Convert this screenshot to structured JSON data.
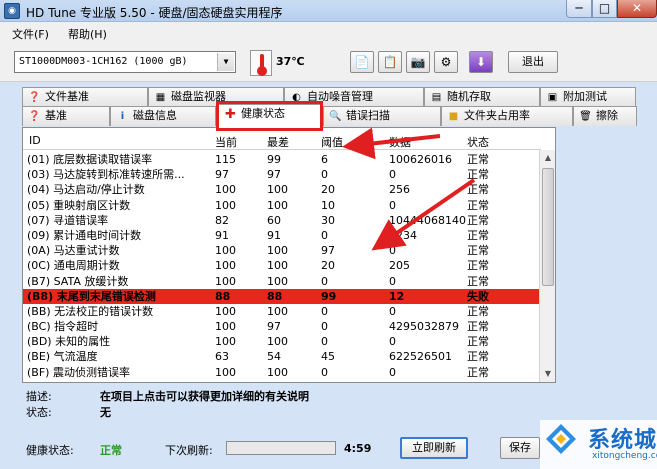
{
  "window": {
    "title": "HD Tune 专业版 5.50 - 硬盘/固态硬盘实用程序",
    "min_glyph": "─",
    "max_glyph": "□",
    "close_glyph": "✕"
  },
  "menu": [
    {
      "label": "文件(F)"
    },
    {
      "label": "帮助(H)"
    }
  ],
  "toolbar": {
    "drive": "ST1000DM003-1CH162 (1000 gB)",
    "temperature": "37℃",
    "exit_label": "退出",
    "icons": [
      "copy-text-icon",
      "copy-icon",
      "camera-icon",
      "options-icon",
      "download-icon"
    ]
  },
  "tabs": {
    "row1": [
      {
        "label": "文件基准"
      },
      {
        "label": "磁盘监视器"
      },
      {
        "label": "自动噪音管理"
      },
      {
        "label": "随机存取"
      },
      {
        "label": "附加测试"
      }
    ],
    "row2": [
      {
        "label": "基准"
      },
      {
        "label": "磁盘信息"
      },
      {
        "label": "健康状态"
      },
      {
        "label": "错误扫描"
      },
      {
        "label": "文件夹占用率"
      },
      {
        "label": "擦除"
      }
    ],
    "active": "健康状态"
  },
  "table": {
    "headers": [
      "ID",
      "当前",
      "最差",
      "阈值",
      "数据",
      "状态"
    ],
    "rows": [
      [
        "(01) 底层数据读取错误率",
        "115",
        "99",
        "6",
        "100626016",
        "正常"
      ],
      [
        "(03) 马达旋转到标准转速所需...",
        "97",
        "97",
        "0",
        "0",
        "正常"
      ],
      [
        "(04) 马达启动/停止计数",
        "100",
        "100",
        "20",
        "256",
        "正常"
      ],
      [
        "(05) 重映射扇区计数",
        "100",
        "100",
        "10",
        "0",
        "正常"
      ],
      [
        "(07) 寻道错误率",
        "82",
        "60",
        "30",
        "10444068140",
        "正常"
      ],
      [
        "(09) 累计通电时间计数",
        "91",
        "91",
        "0",
        "8234",
        "正常"
      ],
      [
        "(0A) 马达重试计数",
        "100",
        "100",
        "97",
        "0",
        "正常"
      ],
      [
        "(0C) 通电周期计数",
        "100",
        "100",
        "20",
        "205",
        "正常"
      ],
      [
        "(B7) SATA 放缓计数",
        "100",
        "100",
        "0",
        "0",
        "正常"
      ],
      [
        "(B8) 末尾到末尾错误检测",
        "88",
        "88",
        "99",
        "12",
        "失败"
      ],
      [
        "(BB) 无法校正的错误计数",
        "100",
        "100",
        "0",
        "0",
        "正常"
      ],
      [
        "(BC) 指令超时",
        "100",
        "97",
        "0",
        "4295032879",
        "正常"
      ],
      [
        "(BD) 未知的属性",
        "100",
        "100",
        "0",
        "0",
        "正常"
      ],
      [
        "(BE) 气流温度",
        "63",
        "54",
        "45",
        "622526501",
        "正常"
      ],
      [
        "(BF) 震动侦测错误率",
        "100",
        "100",
        "0",
        "0",
        "正常"
      ]
    ],
    "failed_row_index": 9
  },
  "description": {
    "desc_label": "描述:",
    "desc_value": "在项目上点击可以获得更加详细的有关说明",
    "status_label": "状态:",
    "status_value": "无"
  },
  "statusbar": {
    "health_label": "健康状态:",
    "health_value": "正常",
    "refresh_label": "下次刷新:",
    "refresh_time": "4:59",
    "refresh_button": "立即刷新",
    "save_button": "保存",
    "progress": 0.0
  },
  "watermark": {
    "cn": "系统城",
    "en": "xitongcheng.com"
  },
  "colors": {
    "fail_row": "#e8271c",
    "ok_text": "#2a9a2a",
    "annotation_red": "#e02020"
  }
}
